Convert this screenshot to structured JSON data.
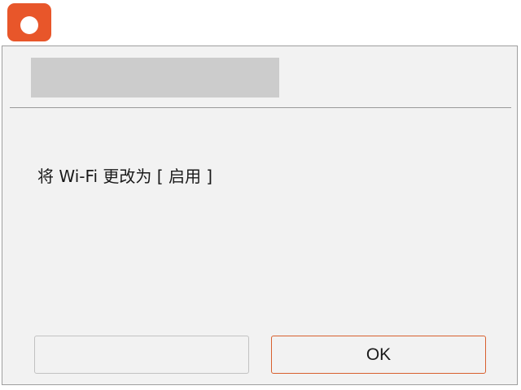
{
  "app": {
    "icon_name": "camera-icon",
    "accent_color": "#e8562a"
  },
  "dialog": {
    "title": "",
    "message": "将 Wi-Fi 更改为 [ 启用 ]",
    "buttons": {
      "secondary_label": "",
      "ok_label": "OK"
    }
  }
}
